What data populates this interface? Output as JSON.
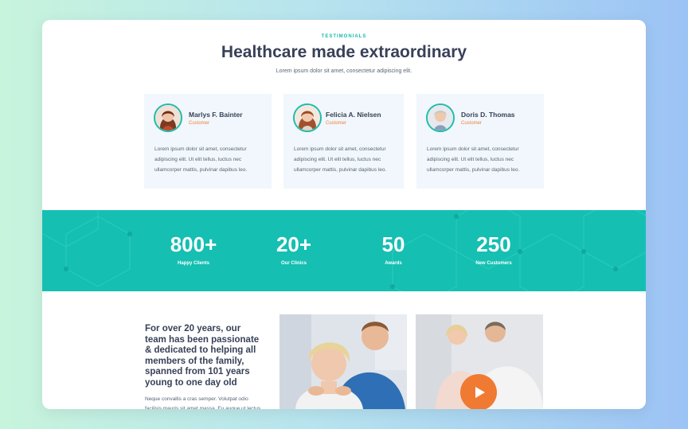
{
  "section": {
    "eyebrow": "TESTIMONIALS",
    "title": "Healthcare made extraordinary",
    "subtitle": "Lorem ipsum dolor sit amet, consectetur adipiscing elit."
  },
  "testimonials": [
    {
      "name": "Marlys F. Bainter",
      "role": "Customer",
      "text": "Lorem ipsum dolor sit amet, consectetur adipiscing elit. Ut elit tellus, luctus nec ullamcorper mattis, pulvinar dapibus leo."
    },
    {
      "name": "Felicia A. Nielsen",
      "role": "Customer",
      "text": "Lorem ipsum dolor sit amet, consectetur adipiscing elit. Ut elit tellus, luctus nec ullamcorper mattis, pulvinar dapibus leo."
    },
    {
      "name": "Doris D. Thomas",
      "role": "Customer",
      "text": "Lorem ipsum dolor sit amet, consectetur adipiscing elit. Ut elit tellus, luctus nec ullamcorper mattis, pulvinar dapibus leo."
    }
  ],
  "stats": [
    {
      "value": "800+",
      "label": "Happy Clients"
    },
    {
      "value": "20+",
      "label": "Our Clinics"
    },
    {
      "value": "50",
      "label": "Awards"
    },
    {
      "value": "250",
      "label": "New Customers"
    }
  ],
  "about": {
    "heading": "For over 20 years, our team has been passionate & dedicated to helping all members of the family, spanned from 101 years young to one day old",
    "body": "Neque convallis a cras semper. Volutpat odio facilisis mauris sit amet massa. Eu augue ut lectus"
  },
  "media": {
    "play_icon": "play-icon"
  },
  "colors": {
    "accent_teal": "#15bfb2",
    "accent_orange": "#f07a32",
    "heading": "#374158"
  }
}
